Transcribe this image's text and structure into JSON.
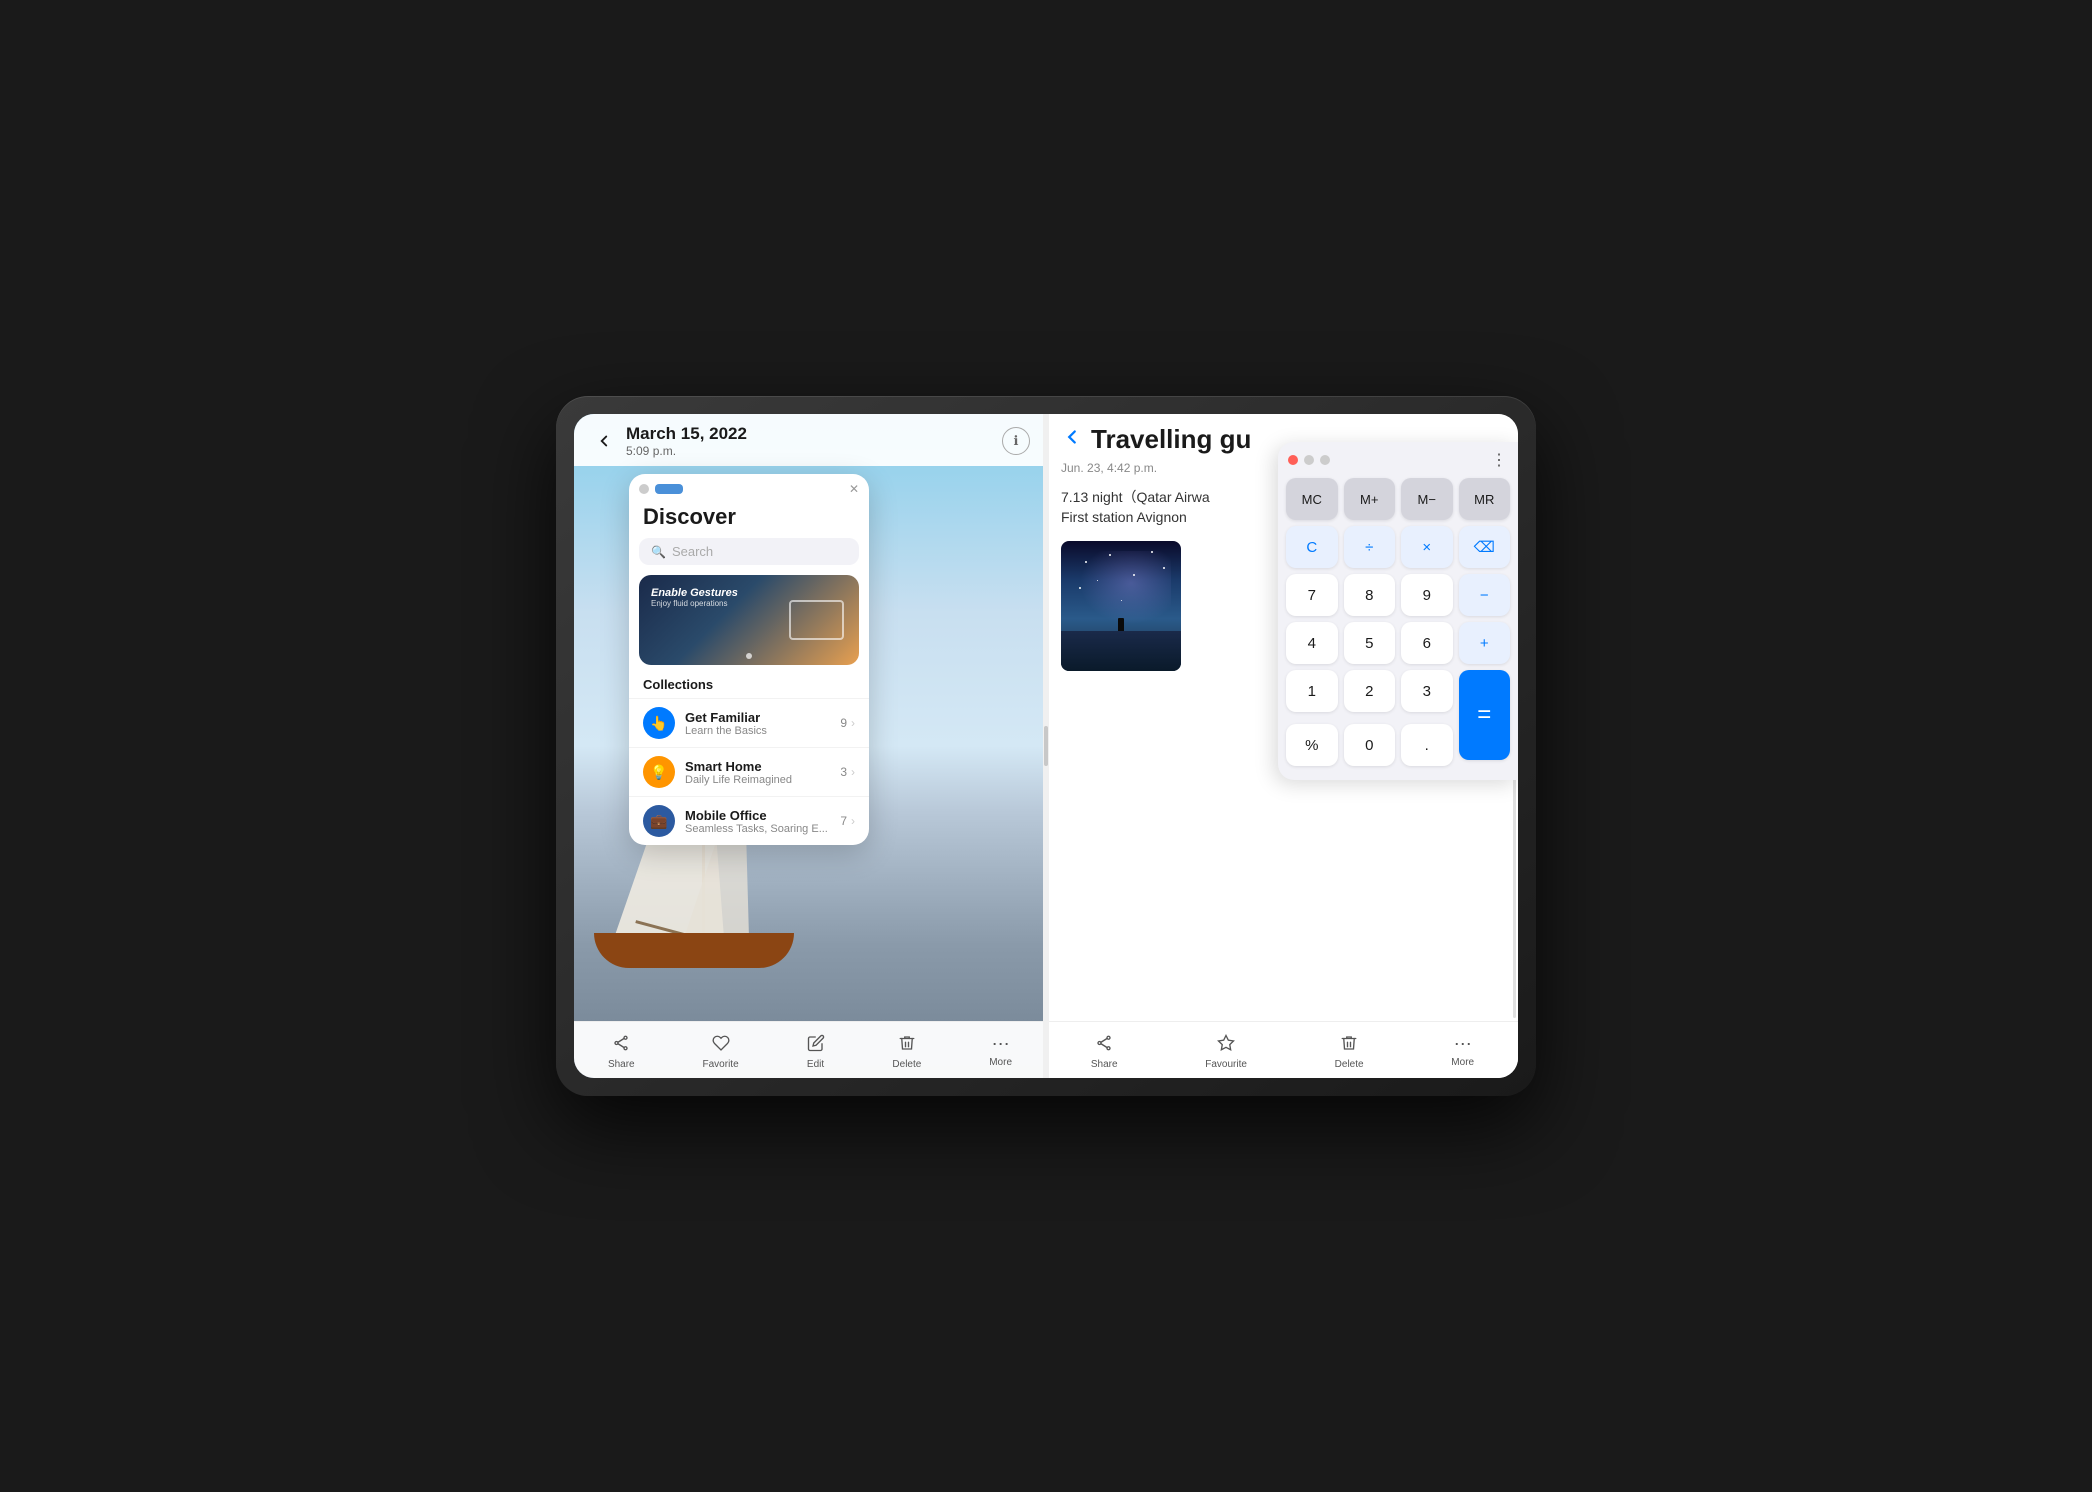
{
  "tablet": {
    "camera": "front-camera"
  },
  "left_panel": {
    "top_bar": {
      "back_label": "←",
      "date": "March 15, 2022",
      "time": "5:09 p.m.",
      "info_label": "ℹ"
    },
    "bottom_bar": {
      "items": [
        {
          "icon": "⤴",
          "label": "Share"
        },
        {
          "icon": "♡",
          "label": "Favorite"
        },
        {
          "icon": "✎",
          "label": "Edit"
        },
        {
          "icon": "🗑",
          "label": "Delete"
        },
        {
          "icon": "⋯",
          "label": "More"
        }
      ]
    },
    "discover_window": {
      "title": "Discover",
      "search_placeholder": "Search",
      "banner": {
        "title": "Enable Gestures",
        "subtitle": "Enjoy fluid operations"
      },
      "collections_label": "Collections",
      "collections": [
        {
          "icon": "👆",
          "icon_color": "blue",
          "name": "Get Familiar",
          "subtitle": "Learn the Basics",
          "count": "9"
        },
        {
          "icon": "💡",
          "icon_color": "orange",
          "name": "Smart Home",
          "subtitle": "Daily Life Reimagined",
          "count": "3"
        },
        {
          "icon": "💼",
          "icon_color": "blue-dark",
          "name": "Mobile Office",
          "subtitle": "Seamless Tasks, Soaring E...",
          "count": "7"
        }
      ]
    }
  },
  "right_panel": {
    "top_bar": {
      "back_label": "←",
      "title": "Travelling gu",
      "more_label": "⋯"
    },
    "note_date": "Jun. 23, 4:42 p.m.",
    "note_lines": [
      "7.13 night（Qatar Airwa",
      "First station  Avignon"
    ],
    "bottom_bar": {
      "items": [
        {
          "icon": "⤴",
          "label": "Share"
        },
        {
          "icon": "☆",
          "label": "Favourite"
        },
        {
          "icon": "🗑",
          "label": "Delete"
        },
        {
          "icon": "⋯",
          "label": "More"
        }
      ]
    }
  },
  "calculator": {
    "buttons": {
      "row1": [
        "MC",
        "M+",
        "M−",
        "MR"
      ],
      "row2": [
        "C",
        "÷",
        "×",
        "⌫"
      ],
      "row3": [
        "7",
        "8",
        "9",
        "−"
      ],
      "row4": [
        "4",
        "5",
        "6",
        "+"
      ],
      "row5_left": [
        "1",
        "2",
        "3"
      ],
      "equals": "=",
      "row6_left": [
        "%",
        "0",
        "."
      ]
    }
  }
}
